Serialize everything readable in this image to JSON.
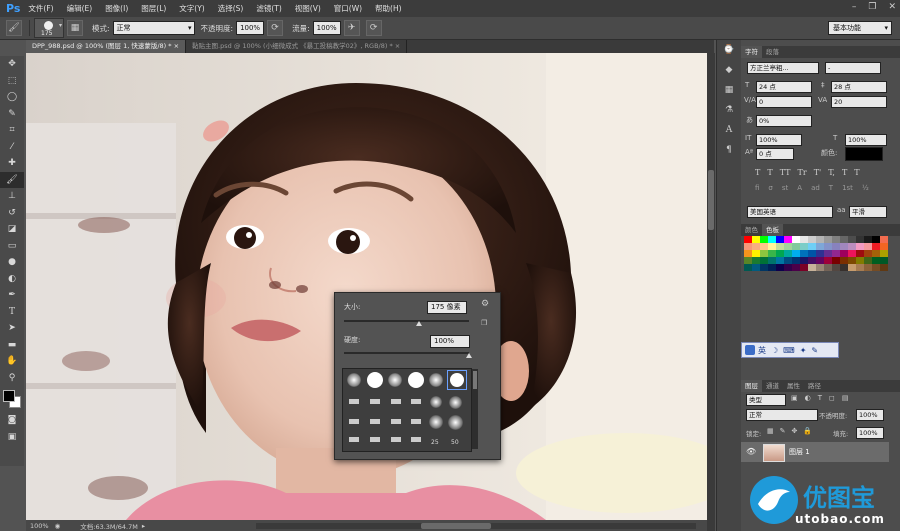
{
  "app": {
    "logo": "Ps"
  },
  "menu": [
    "文件(F)",
    "编辑(E)",
    "图像(I)",
    "图层(L)",
    "文字(Y)",
    "选择(S)",
    "滤镜(T)",
    "视图(V)",
    "窗口(W)",
    "帮助(H)"
  ],
  "window_controls": {
    "minimize": "–",
    "restore": "❐",
    "close": "✕"
  },
  "options": {
    "brush_size": "175",
    "mode_label": "模式:",
    "mode_value": "正常",
    "opacity_label": "不透明度:",
    "opacity_value": "100%",
    "flow_label": "流量:",
    "flow_value": "100%",
    "workspace": "基本功能"
  },
  "tabs": [
    {
      "label": "DPP_988.psd @ 100% (图层 1, 快速蒙版/8) * ×",
      "active": true
    },
    {
      "label": "黏贴主图.psd @ 100% (小细微成式 《暴工投稿教学02》, RGB/8) * ×",
      "active": false
    }
  ],
  "tools": [
    "move-icon",
    "marquee-icon",
    "lasso-icon",
    "quick-select-icon",
    "crop-icon",
    "eyedropper-icon",
    "healing-icon",
    "brush-icon",
    "stamp-icon",
    "history-brush-icon",
    "eraser-icon",
    "gradient-icon",
    "blur-icon",
    "dodge-icon",
    "pen-icon",
    "type-icon",
    "path-select-icon",
    "shape-icon",
    "hand-icon",
    "zoom-icon"
  ],
  "status": {
    "zoom": "100%",
    "doc": "文档:63.3M/64.7M"
  },
  "brush_popup": {
    "size_label": "大小:",
    "size_value": "175 像素",
    "hardness_label": "硬度:",
    "hardness_value": "100%",
    "size_level": 0.6,
    "hardness_level": 1.0,
    "labels": [
      "25",
      "50"
    ]
  },
  "character_panel": {
    "tabs": [
      "字符",
      "段落"
    ],
    "font_family": "方正兰亭粗...",
    "font_style": "-",
    "font_size": "24 点",
    "leading": "28 点",
    "kerning": "0",
    "tracking": "20",
    "scale_percent": "0%",
    "vertical_scale": "100%",
    "horizontal_scale": "100%",
    "baseline": "0 点",
    "color_label": "颜色:",
    "language": "美国英语",
    "aa_label": "aa",
    "aa_value": "平滑",
    "text_style_glyphs": [
      "T",
      "T",
      "TT",
      "Tr",
      "T'",
      "T,",
      "T",
      "T"
    ],
    "text_glyphs2": [
      "fi",
      "σ",
      "st",
      "A",
      "ad",
      "T",
      "1st",
      "½"
    ]
  },
  "color_panel": {
    "tabs": [
      "颜色",
      "色板"
    ]
  },
  "ime": {
    "label": "英",
    "icons": [
      "☽",
      "⌨",
      "✦",
      "✎"
    ]
  },
  "layers_panel": {
    "tabs": [
      "图层",
      "通道",
      "属性",
      "路径"
    ],
    "filter_label": "类型",
    "blend_mode": "正常",
    "opacity_label": "不透明度:",
    "opacity_value": "100%",
    "lock_label": "锁定:",
    "fill_label": "填充:",
    "fill_value": "100%",
    "layer_name": "图层 1"
  },
  "watermark": {
    "title": "优图宝",
    "url": "utobao.com"
  }
}
